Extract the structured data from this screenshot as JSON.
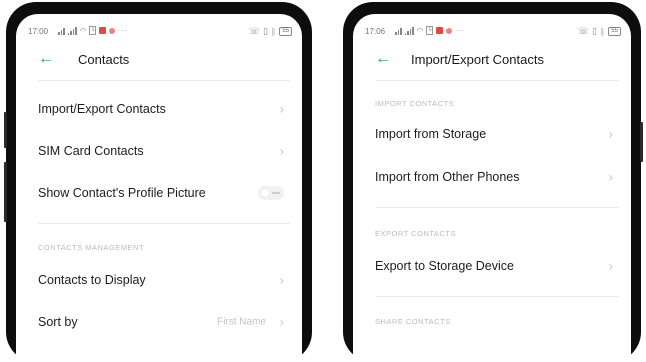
{
  "left_phone": {
    "status": {
      "time": "17:00",
      "battery": "55",
      "icons": [
        "signal-icon",
        "wifi-icon",
        "sim-icon",
        "notification-icon",
        "more-icon",
        "call-icon",
        "vibrate-icon",
        "bluetooth-icon",
        "battery-icon"
      ]
    },
    "header": {
      "back_icon": "←",
      "title": "Contacts"
    },
    "items": [
      {
        "label": "Import/Export Contacts",
        "chevron": "›"
      },
      {
        "label": "SIM Card Contacts",
        "chevron": "›"
      },
      {
        "label": "Show Contact's Profile Picture",
        "toggle": false
      }
    ],
    "section_management": "CONTACTS MANAGEMENT",
    "management_items": [
      {
        "label": "Contacts to Display",
        "chevron": "›"
      },
      {
        "label": "Sort by",
        "value": "First Name",
        "chevron": "›"
      }
    ]
  },
  "right_phone": {
    "status": {
      "time": "17:06",
      "battery": "55"
    },
    "header": {
      "back_icon": "←",
      "title": "Import/Export Contacts"
    },
    "section_import": "IMPORT CONTACTS",
    "import_items": [
      {
        "label": "Import from Storage",
        "chevron": "›"
      },
      {
        "label": "Import from Other Phones",
        "chevron": "›"
      }
    ],
    "section_export": "EXPORT CONTACTS",
    "export_items": [
      {
        "label": "Export to Storage Device",
        "chevron": "›"
      }
    ],
    "section_share": "SHARE CONTACTS"
  },
  "colors": {
    "accent": "#28a84c",
    "phone_frame": "#0d0d0d",
    "section_text": "#bcbcbc",
    "chevron": "#c6c6c6"
  }
}
